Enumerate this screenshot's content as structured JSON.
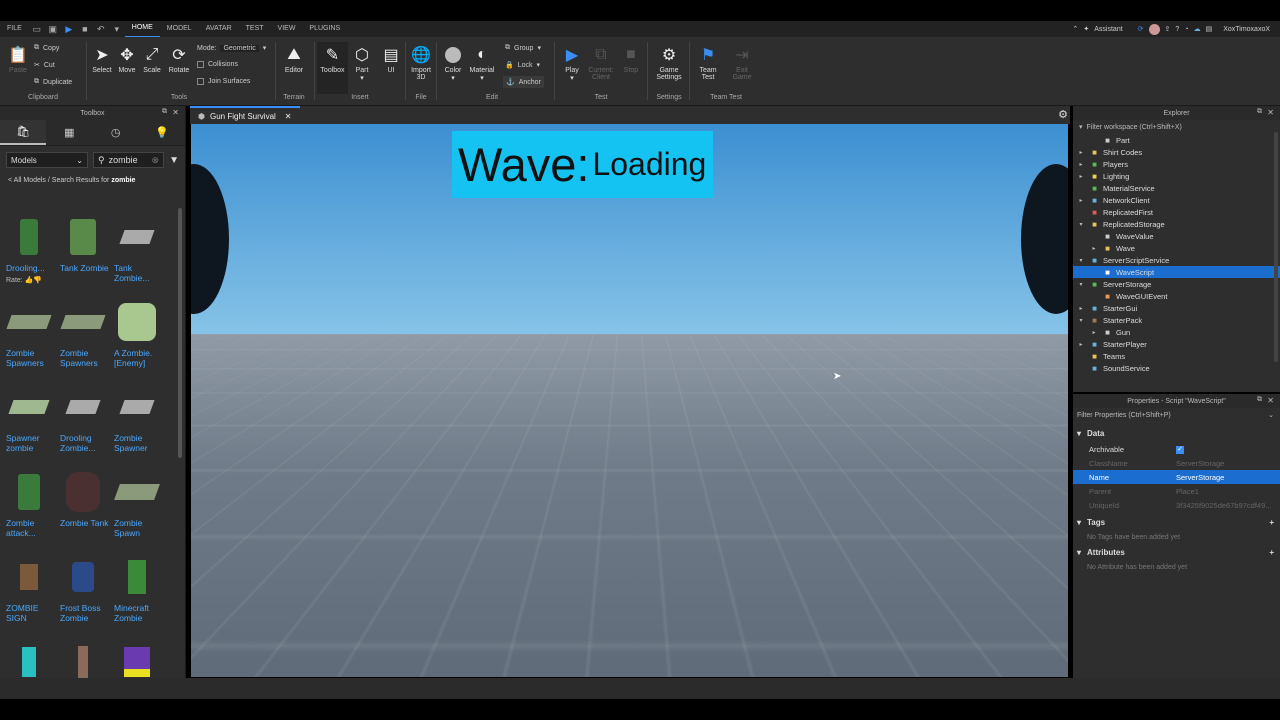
{
  "menu": {
    "file": "FILE",
    "tabs": [
      "HOME",
      "MODEL",
      "AVATAR",
      "TEST",
      "VIEW",
      "PLUGINS"
    ],
    "assistant": "Assistant",
    "user": "XoxTimoxaxoX"
  },
  "ribbon": {
    "clipboard": {
      "paste": "Paste",
      "copy": "Copy",
      "cut": "Cut",
      "duplicate": "Duplicate",
      "label": "Clipboard"
    },
    "tools": {
      "select": "Select",
      "move": "Move",
      "scale": "Scale",
      "rotate": "Rotate",
      "mode_label": "Mode:",
      "mode_value": "Geometric",
      "collisions": "Collisions",
      "join_surfaces": "Join Surfaces",
      "label": "Tools"
    },
    "terrain": {
      "editor": "Editor",
      "label": "Terrain"
    },
    "insert": {
      "toolbox": "Toolbox",
      "part": "Part",
      "ui": "UI",
      "label": "Insert"
    },
    "file": {
      "import3d": "Import 3D",
      "label": "File"
    },
    "edit": {
      "color": "Color",
      "material": "Material",
      "group": "Group",
      "lock": "Lock",
      "anchor": "Anchor",
      "label": "Edit"
    },
    "test": {
      "play": "Play",
      "current_client": "Current: Client",
      "stop": "Stop",
      "label": "Test"
    },
    "settings": {
      "game_settings": "Game Settings",
      "label": "Settings"
    },
    "team_test": {
      "team_test": "Team Test",
      "exit_game": "Exit Game",
      "label": "Team Test"
    }
  },
  "toolbox": {
    "title": "Toolbox",
    "category": "Models",
    "search": "zombie",
    "breadcrumb_prefix": "< All Models / Search Results for",
    "breadcrumb_term": "zombie",
    "rate_label": "Rate:",
    "items": [
      "Drooling...",
      "Tank Zombie",
      "Tank Zombie...",
      "Zombie Spawners",
      "Zombie Spawners",
      "A Zombie. [Enemy]",
      "Spawner zombie",
      "Drooling Zombie...",
      "Zombie Spawner",
      "Zombie attack...",
      "Zombie Tank",
      "Zombie Spawn",
      "ZOMBIE SIGN",
      "Frost Boss Zombie",
      "Minecraft Zombie",
      "",
      "",
      ""
    ]
  },
  "document": {
    "tab": "Gun Fight Survival"
  },
  "viewport": {
    "wave_label": "Wave:",
    "wave_value": "Loading"
  },
  "explorer": {
    "title": "Explorer",
    "filter": "Filter workspace (Ctrl+Shift+X)",
    "rows": [
      {
        "label": "Part",
        "icon": "part-icon",
        "color": "#ccc"
      },
      {
        "label": "Shirt Codes",
        "icon": "folder-icon",
        "color": "#e8c25a"
      },
      {
        "label": "Players",
        "icon": "players-icon",
        "color": "#5ab85a"
      },
      {
        "label": "Lighting",
        "icon": "lighting-icon",
        "color": "#f2d04a"
      },
      {
        "label": "MaterialService",
        "icon": "material-service-icon",
        "color": "#5ab85a"
      },
      {
        "label": "NetworkClient",
        "icon": "network-client-icon",
        "color": "#6ab0e0"
      },
      {
        "label": "ReplicatedFirst",
        "icon": "replicated-first-icon",
        "color": "#e05a5a"
      },
      {
        "label": "ReplicatedStorage",
        "icon": "replicated-storage-icon",
        "color": "#e8c25a"
      },
      {
        "label": "WaveValue",
        "icon": "int-value-icon",
        "color": "#ccc"
      },
      {
        "label": "Wave",
        "icon": "remote-event-icon",
        "color": "#e8c25a"
      },
      {
        "label": "ServerScriptService",
        "icon": "server-script-service-icon",
        "color": "#6ab0e0"
      },
      {
        "label": "WaveScript",
        "icon": "script-icon",
        "color": "#fff"
      },
      {
        "label": "ServerStorage",
        "icon": "server-storage-icon",
        "color": "#5ab85a"
      },
      {
        "label": "WaveGUIEvent",
        "icon": "remote-event-icon",
        "color": "#e89a5a"
      },
      {
        "label": "StarterGui",
        "icon": "starter-gui-icon",
        "color": "#6ab0e0"
      },
      {
        "label": "StarterPack",
        "icon": "starter-pack-icon",
        "color": "#a07850"
      },
      {
        "label": "Gun",
        "icon": "tool-icon",
        "color": "#ccc"
      },
      {
        "label": "StarterPlayer",
        "icon": "starter-player-icon",
        "color": "#6ab0e0"
      },
      {
        "label": "Teams",
        "icon": "teams-icon",
        "color": "#e8c25a"
      },
      {
        "label": "SoundService",
        "icon": "sound-service-icon",
        "color": "#6ab0e0"
      }
    ]
  },
  "properties": {
    "title": "Properties - Script \"WaveScript\"",
    "filter": "Filter Properties (Ctrl+Shift+P)",
    "data_group": "Data",
    "rows": [
      {
        "name": "Archivable",
        "value": ""
      },
      {
        "name": "ClassName",
        "value": "ServerStorage"
      },
      {
        "name": "Name",
        "value": "ServerStorage"
      },
      {
        "name": "Parent",
        "value": "Place1"
      },
      {
        "name": "UniqueId",
        "value": "3f3425f9025de67b97cdf49..."
      }
    ],
    "tags_group": "Tags",
    "tags_empty": "No Tags have been added yet",
    "attributes_group": "Attributes",
    "attributes_empty": "No Attribute has been added yet"
  }
}
